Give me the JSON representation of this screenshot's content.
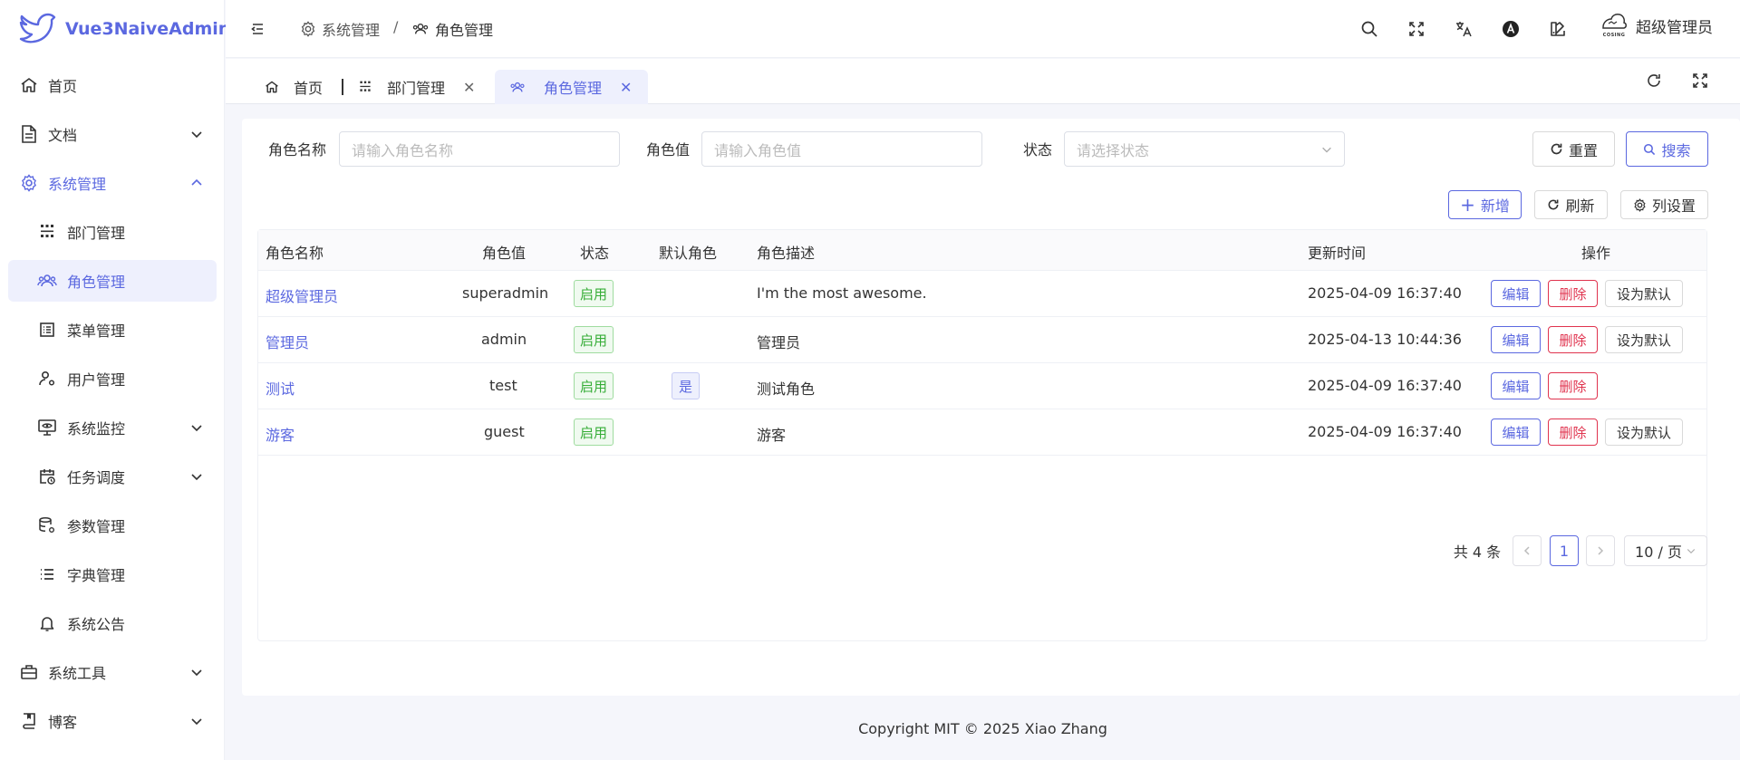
{
  "app": {
    "title": "Vue3NaiveAdmin"
  },
  "sidebar": {
    "items": [
      {
        "label": "首页",
        "icon": "home-icon"
      },
      {
        "label": "文档",
        "icon": "document-icon"
      },
      {
        "label": "系统管理",
        "icon": "gear-icon"
      },
      {
        "label": "部门管理",
        "icon": "org-chart-icon"
      },
      {
        "label": "角色管理",
        "icon": "users-icon"
      },
      {
        "label": "菜单管理",
        "icon": "list-box-icon"
      },
      {
        "label": "用户管理",
        "icon": "user-gear-icon"
      },
      {
        "label": "系统监控",
        "icon": "monitor-eye-icon"
      },
      {
        "label": "任务调度",
        "icon": "calendar-clock-icon"
      },
      {
        "label": "参数管理",
        "icon": "database-gear-icon"
      },
      {
        "label": "字典管理",
        "icon": "list-icon"
      },
      {
        "label": "系统公告",
        "icon": "bell-icon"
      },
      {
        "label": "系统工具",
        "icon": "toolbox-icon"
      },
      {
        "label": "博客",
        "icon": "bookmark-book-icon"
      }
    ]
  },
  "header": {
    "breadcrumb": [
      "系统管理",
      "角色管理"
    ],
    "separator": "/",
    "user_name": "超级管理员",
    "avatar_text": "COSING"
  },
  "tabs": [
    {
      "label": "首页"
    },
    {
      "label": "部门管理"
    },
    {
      "label": "角色管理"
    }
  ],
  "search": {
    "name_label": "角色名称",
    "name_placeholder": "请输入角色名称",
    "value_label": "角色值",
    "value_placeholder": "请输入角色值",
    "status_label": "状态",
    "status_placeholder": "请选择状态",
    "reset_label": "重置",
    "search_label": "搜索"
  },
  "toolbar": {
    "add_label": "新增",
    "refresh_label": "刷新",
    "columns_label": "列设置"
  },
  "table": {
    "columns": [
      "角色名称",
      "角色值",
      "状态",
      "默认角色",
      "角色描述",
      "更新时间",
      "操作"
    ],
    "rows": [
      {
        "name": "超级管理员",
        "value": "superadmin",
        "status": "启用",
        "default": "",
        "desc": "I'm the most awesome.",
        "updated": "2025-04-09 16:37:40"
      },
      {
        "name": "管理员",
        "value": "admin",
        "status": "启用",
        "default": "",
        "desc": "管理员",
        "updated": "2025-04-13 10:44:36"
      },
      {
        "name": "测试",
        "value": "test",
        "status": "启用",
        "default": "是",
        "desc": "测试角色",
        "updated": "2025-04-09 16:37:40"
      },
      {
        "name": "游客",
        "value": "guest",
        "status": "启用",
        "default": "",
        "desc": "游客",
        "updated": "2025-04-09 16:37:40"
      }
    ],
    "actions": {
      "edit": "编辑",
      "delete": "删除",
      "set_default": "设为默认"
    }
  },
  "pagination": {
    "total_text": "共 4 条",
    "current_page": "1",
    "page_size": "10 / 页"
  },
  "footer": {
    "text": "Copyright MIT © 2025 Xiao Zhang"
  },
  "colors": {
    "primary": "#5b68e0",
    "success": "#36ad37",
    "danger": "#e0334e"
  }
}
